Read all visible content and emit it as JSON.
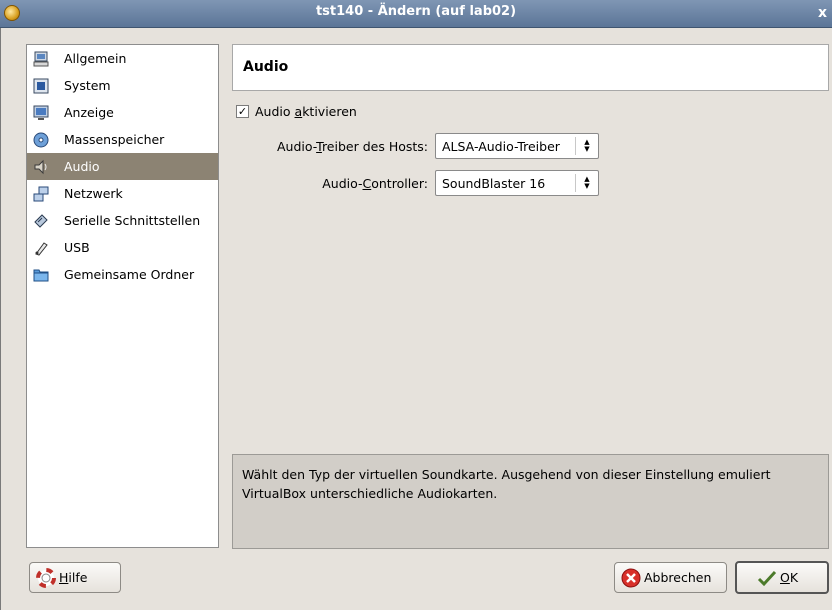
{
  "window": {
    "title": "tst140 - Ändern (auf lab02)",
    "close_glyph": "x"
  },
  "sidebar": {
    "items": [
      {
        "label": "Allgemein",
        "icon": "computer-icon"
      },
      {
        "label": "System",
        "icon": "chip-icon"
      },
      {
        "label": "Anzeige",
        "icon": "monitor-icon"
      },
      {
        "label": "Massenspeicher",
        "icon": "disk-icon"
      },
      {
        "label": "Audio",
        "icon": "speaker-icon",
        "selected": true
      },
      {
        "label": "Netzwerk",
        "icon": "network-icon"
      },
      {
        "label": "Serielle Schnittstellen",
        "icon": "serial-port-icon"
      },
      {
        "label": "USB",
        "icon": "usb-icon"
      },
      {
        "label": "Gemeinsame Ordner",
        "icon": "folder-icon"
      }
    ]
  },
  "page": {
    "header": "Audio",
    "enable_audio": {
      "pre": "Audio ",
      "mnemonic": "a",
      "post": "ktivieren",
      "checked": true
    },
    "host_driver": {
      "label_pre": "Audio-",
      "label_mnemonic": "T",
      "label_post": "reiber des Hosts:",
      "value": "ALSA-Audio-Treiber"
    },
    "controller": {
      "label_pre": "Audio-",
      "label_mnemonic": "C",
      "label_post": "ontroller:",
      "value": "SoundBlaster 16"
    },
    "description": "Wählt den Typ der virtuellen Soundkarte. Ausgehend von dieser Einstellung emuliert VirtualBox unterschiedliche Audiokarten."
  },
  "buttons": {
    "help_mnemonic": "H",
    "help_rest": "ilfe",
    "cancel": "Abbrechen",
    "ok_mnemonic": "O",
    "ok_rest": "K"
  },
  "colors": {
    "selection": "#8c8373",
    "titlebar": "#6b84a5",
    "dialog_bg": "#e6e2dc"
  }
}
